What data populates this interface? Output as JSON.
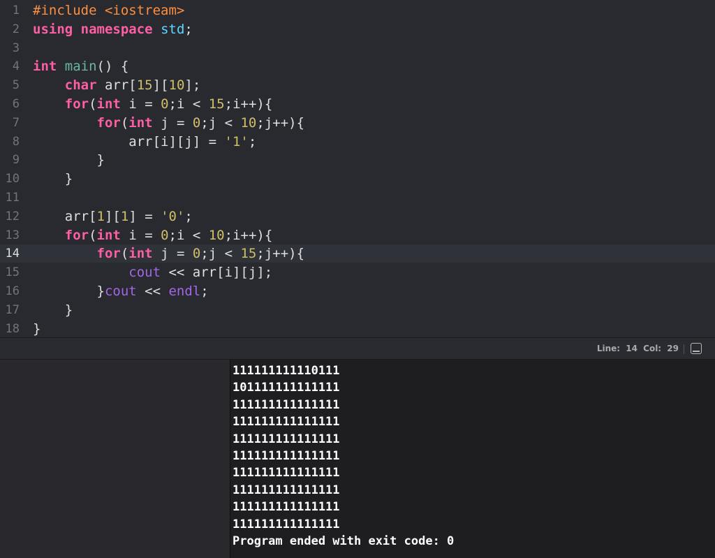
{
  "editor": {
    "current_line": 14,
    "lines": [
      {
        "n": "1",
        "tokens": [
          [
            "pp",
            "#include <iostream>"
          ]
        ]
      },
      {
        "n": "2",
        "tokens": [
          [
            "kw",
            "using"
          ],
          [
            "pl",
            " "
          ],
          [
            "kw",
            "namespace"
          ],
          [
            "pl",
            " "
          ],
          [
            "std",
            "std"
          ],
          [
            "pl",
            ";"
          ]
        ]
      },
      {
        "n": "3",
        "tokens": []
      },
      {
        "n": "4",
        "tokens": [
          [
            "kw",
            "int"
          ],
          [
            "pl",
            " "
          ],
          [
            "fn",
            "main"
          ],
          [
            "pl",
            "() {"
          ]
        ]
      },
      {
        "n": "5",
        "tokens": [
          [
            "pl",
            "    "
          ],
          [
            "kw",
            "char"
          ],
          [
            "pl",
            " arr["
          ],
          [
            "num",
            "15"
          ],
          [
            "pl",
            "]["
          ],
          [
            "num",
            "10"
          ],
          [
            "pl",
            "];"
          ]
        ]
      },
      {
        "n": "6",
        "tokens": [
          [
            "pl",
            "    "
          ],
          [
            "kw",
            "for"
          ],
          [
            "pl",
            "("
          ],
          [
            "kw",
            "int"
          ],
          [
            "pl",
            " i = "
          ],
          [
            "num",
            "0"
          ],
          [
            "pl",
            ";i < "
          ],
          [
            "num",
            "15"
          ],
          [
            "pl",
            ";i++){"
          ]
        ]
      },
      {
        "n": "7",
        "tokens": [
          [
            "pl",
            "        "
          ],
          [
            "kw",
            "for"
          ],
          [
            "pl",
            "("
          ],
          [
            "kw",
            "int"
          ],
          [
            "pl",
            " j = "
          ],
          [
            "num",
            "0"
          ],
          [
            "pl",
            ";j < "
          ],
          [
            "num",
            "10"
          ],
          [
            "pl",
            ";j++){"
          ]
        ]
      },
      {
        "n": "8",
        "tokens": [
          [
            "pl",
            "            arr[i][j] = "
          ],
          [
            "num",
            "'1'"
          ],
          [
            "pl",
            ";"
          ]
        ]
      },
      {
        "n": "9",
        "tokens": [
          [
            "pl",
            "        }"
          ]
        ]
      },
      {
        "n": "10",
        "tokens": [
          [
            "pl",
            "    }"
          ]
        ]
      },
      {
        "n": "11",
        "tokens": []
      },
      {
        "n": "12",
        "tokens": [
          [
            "pl",
            "    arr["
          ],
          [
            "num",
            "1"
          ],
          [
            "pl",
            "]["
          ],
          [
            "num",
            "1"
          ],
          [
            "pl",
            "] = "
          ],
          [
            "num",
            "'0'"
          ],
          [
            "pl",
            ";"
          ]
        ]
      },
      {
        "n": "13",
        "tokens": [
          [
            "pl",
            "    "
          ],
          [
            "kw",
            "for"
          ],
          [
            "pl",
            "("
          ],
          [
            "kw",
            "int"
          ],
          [
            "pl",
            " i = "
          ],
          [
            "num",
            "0"
          ],
          [
            "pl",
            ";i < "
          ],
          [
            "num",
            "10"
          ],
          [
            "pl",
            ";i++){"
          ]
        ]
      },
      {
        "n": "14",
        "tokens": [
          [
            "pl",
            "        "
          ],
          [
            "kw",
            "for"
          ],
          [
            "pl",
            "("
          ],
          [
            "kw",
            "int"
          ],
          [
            "pl",
            " j = "
          ],
          [
            "num",
            "0"
          ],
          [
            "pl",
            ";j < "
          ],
          [
            "num",
            "15"
          ],
          [
            "pl",
            ";j++){"
          ]
        ]
      },
      {
        "n": "15",
        "tokens": [
          [
            "pl",
            "            "
          ],
          [
            "sym",
            "cout"
          ],
          [
            "pl",
            " << arr[i][j];"
          ]
        ]
      },
      {
        "n": "16",
        "tokens": [
          [
            "pl",
            "        }"
          ],
          [
            "sym",
            "cout"
          ],
          [
            "pl",
            " << "
          ],
          [
            "sym",
            "endl"
          ],
          [
            "pl",
            ";"
          ]
        ]
      },
      {
        "n": "17",
        "tokens": [
          [
            "pl",
            "    }"
          ]
        ]
      },
      {
        "n": "18",
        "tokens": [
          [
            "pl",
            "}"
          ]
        ]
      }
    ]
  },
  "statusbar": {
    "line_label": "Line:",
    "line_value": "14",
    "col_label": "Col:",
    "col_value": "29",
    "toggle_icon": "console-toggle-icon"
  },
  "console": {
    "lines": [
      "111111111110111",
      "101111111111111",
      "111111111111111",
      "111111111111111",
      "111111111111111",
      "111111111111111",
      "111111111111111",
      "111111111111111",
      "111111111111111",
      "111111111111111",
      "Program ended with exit code: 0"
    ]
  },
  "colors": {
    "keyword": "#fc5fa3",
    "preprocessor": "#fd8f3f",
    "function": "#67b7a4",
    "number": "#d0bf69",
    "symbol": "#a167e6",
    "std": "#5dd8ff",
    "plain": "#dfdfe0",
    "background": "#292a30"
  }
}
